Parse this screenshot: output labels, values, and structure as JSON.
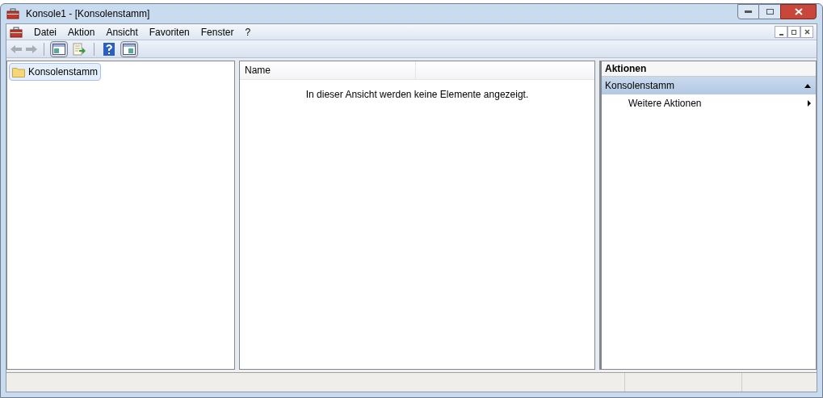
{
  "window": {
    "title": "Konsole1 - [Konsolenstamm]"
  },
  "menu": [
    {
      "label": "Datei"
    },
    {
      "label": "Aktion"
    },
    {
      "label": "Ansicht"
    },
    {
      "label": "Favoriten"
    },
    {
      "label": "Fenster"
    },
    {
      "label": "?"
    }
  ],
  "toolbar": [
    {
      "kind": "back",
      "disabled": true
    },
    {
      "kind": "forward",
      "disabled": true
    },
    {
      "kind": "separator"
    },
    {
      "kind": "tree",
      "pressed": true
    },
    {
      "kind": "export",
      "pressed": false
    },
    {
      "kind": "separator"
    },
    {
      "kind": "help",
      "pressed": false
    },
    {
      "kind": "actionpane",
      "pressed": true
    }
  ],
  "tree": {
    "items": [
      {
        "label": "Konsolenstamm",
        "selected": true
      }
    ]
  },
  "list": {
    "columns": [
      "Name"
    ],
    "empty_message": "In dieser Ansicht werden keine Elemente angezeigt."
  },
  "actions": {
    "title": "Aktionen",
    "groups": [
      {
        "label": "Konsolenstamm",
        "expanded": true,
        "items": [
          {
            "label": "Weitere Aktionen"
          }
        ]
      }
    ]
  }
}
